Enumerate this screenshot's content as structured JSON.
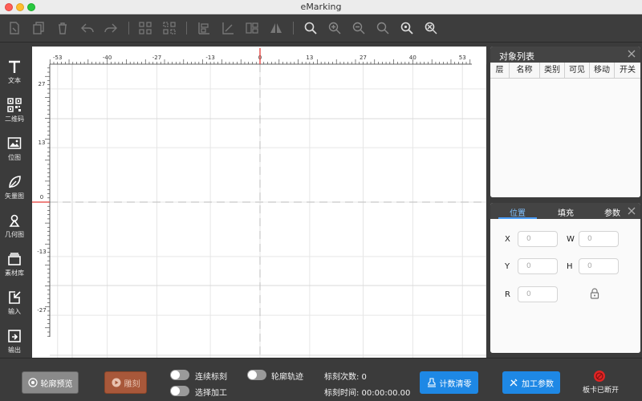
{
  "window": {
    "title": "eMarking"
  },
  "toolbar": {
    "buttons": [
      {
        "name": "new-file-icon"
      },
      {
        "name": "copy-icon"
      },
      {
        "name": "delete-icon"
      },
      {
        "name": "undo-icon"
      },
      {
        "name": "redo-icon"
      },
      {
        "name": "group-icon"
      },
      {
        "name": "ungroup-icon"
      },
      {
        "name": "align-icon"
      },
      {
        "name": "distribute-icon"
      },
      {
        "name": "layout-icon"
      },
      {
        "name": "mirror-icon"
      },
      {
        "name": "search-icon"
      },
      {
        "name": "zoom-in-icon"
      },
      {
        "name": "zoom-out-icon"
      },
      {
        "name": "zoom-reset-icon"
      },
      {
        "name": "zoom-fit-icon"
      },
      {
        "name": "zoom-selection-icon"
      }
    ]
  },
  "sidebar": {
    "items": [
      {
        "label": "文本",
        "icon": "text-icon"
      },
      {
        "label": "二维码",
        "icon": "qrcode-icon"
      },
      {
        "label": "位图",
        "icon": "bitmap-icon"
      },
      {
        "label": "矢量图",
        "icon": "vector-icon"
      },
      {
        "label": "几何图",
        "icon": "geometry-icon"
      },
      {
        "label": "素材库",
        "icon": "material-library-icon"
      },
      {
        "label": "输入",
        "icon": "import-icon"
      },
      {
        "label": "输出",
        "icon": "export-icon"
      }
    ]
  },
  "ruler": {
    "top_ticks": [
      "-53",
      "-40",
      "-27",
      "-13",
      "0",
      "13",
      "27",
      "40",
      "53"
    ],
    "left_ticks": [
      "27",
      "13",
      "0",
      "-13",
      "-27"
    ]
  },
  "object_panel": {
    "title": "对象列表",
    "columns": [
      "层",
      "名称",
      "类别",
      "可见",
      "移动",
      "开关"
    ]
  },
  "props_panel": {
    "tabs": [
      "位置",
      "填充",
      "参数"
    ],
    "active_tab": "位置",
    "fields": {
      "x_label": "X",
      "x_value": "0",
      "w_label": "W",
      "w_value": "0",
      "y_label": "Y",
      "y_value": "0",
      "h_label": "H",
      "h_value": "0",
      "r_label": "R",
      "r_value": "0"
    }
  },
  "bottom": {
    "preview_label": "轮廓预览",
    "engrave_label": "雕刻",
    "continuous_label": "连续标刻",
    "outline_track_label": "轮廓轨迹",
    "select_process_label": "选择加工",
    "count_label": "标刻次数: 0",
    "time_label": "标刻时间: 00:00:00.00",
    "reset_count_label": "计数清零",
    "process_params_label": "加工参数",
    "disconnect_label": "板卡已断开"
  },
  "colors": {
    "accent": "#1e88e5",
    "engrave": "#a8583a",
    "disconnect": "#e02424",
    "origin": "#e53935"
  }
}
